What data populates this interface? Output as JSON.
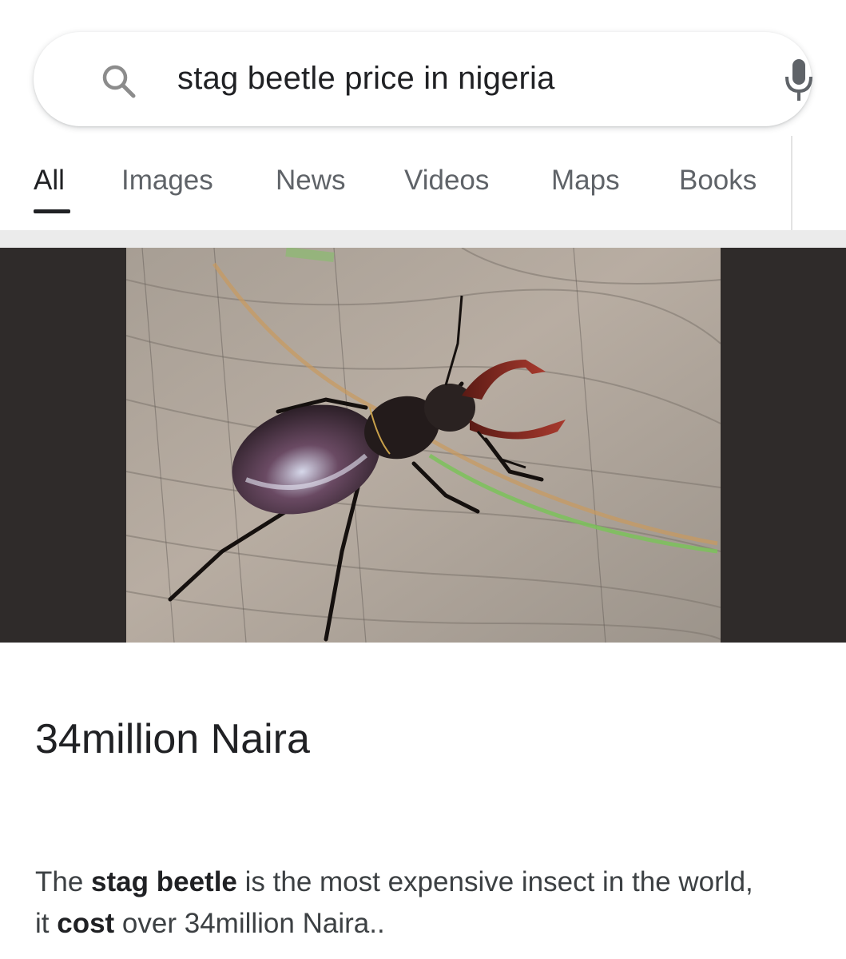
{
  "search": {
    "query": "stag beetle price in nigeria",
    "search_icon": "magnifier-icon",
    "voice_icon": "microphone-icon"
  },
  "tabs": [
    {
      "label": "All",
      "active": true
    },
    {
      "label": "Images",
      "active": false
    },
    {
      "label": "News",
      "active": false
    },
    {
      "label": "Videos",
      "active": false
    },
    {
      "label": "Maps",
      "active": false
    },
    {
      "label": "Books",
      "active": false
    }
  ],
  "result": {
    "image_subject": "stag beetle on weathered wood",
    "answer": "34million Naira",
    "snippet": {
      "part1": "The ",
      "bold1": "stag beetle",
      "part2": " is the most expensive insect in the world,",
      "part3": "it ",
      "bold2": "cost",
      "part4": " over 34million Naira.."
    }
  },
  "colors": {
    "tab_active": "#202124",
    "tab_inactive": "#5f6368",
    "image_letterbox": "#2f2b2a"
  }
}
